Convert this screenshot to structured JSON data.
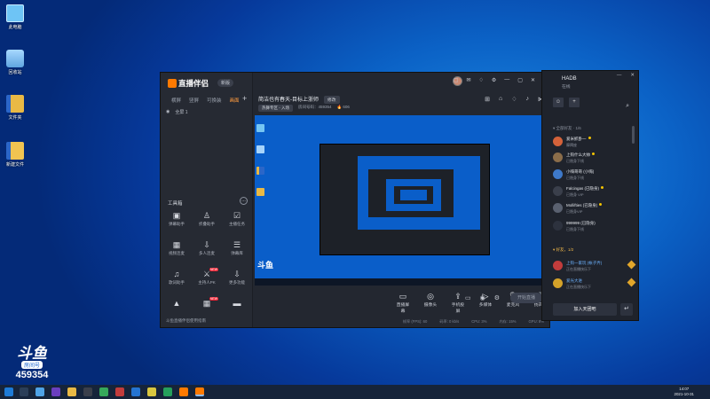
{
  "desktop": {
    "icons": [
      {
        "label": "此电脑"
      },
      {
        "label": "回收站"
      },
      {
        "label": "文件夹"
      },
      {
        "label": "新建文件"
      },
      {
        "label": "文件夹"
      }
    ]
  },
  "main_window": {
    "app_name": "直播伴侣",
    "version_pill": "新版",
    "scene_tabs": [
      "横屏",
      "竖屏",
      "可换装",
      "画面"
    ],
    "active_scene_tab": "画面",
    "add_tab": "+",
    "scene_row": [
      "◉",
      "全屏 1"
    ],
    "tools_title": "工具箱",
    "tools_more": "…",
    "tools": [
      {
        "label": "弹幕助手",
        "icon": "▣"
      },
      {
        "label": "折叠助手",
        "icon": "♙"
      },
      {
        "label": "主播任务",
        "icon": "☑"
      },
      {
        "label": "视频连麦",
        "icon": "▦"
      },
      {
        "label": "多人连麦",
        "icon": "⇩"
      },
      {
        "label": "弹幕库",
        "icon": "☰"
      },
      {
        "label": "歌词助手",
        "icon": "♫"
      },
      {
        "label": "主持人PK",
        "icon": "⚔",
        "badge": "NEW"
      },
      {
        "label": "更多功能",
        "icon": "⇩"
      },
      {
        "label": "",
        "icon": "▲"
      },
      {
        "label": "",
        "icon": "▦",
        "badge": "NEW"
      },
      {
        "label": "",
        "icon": "▬"
      }
    ],
    "footer_note": "斗鱼直播伴侣使用指南",
    "room_title": "简洁也有春天-目标上浙师",
    "edit_btn": "修改",
    "room_category": "热舞专区 - 入场",
    "room_id_label": "房间号码：459354",
    "fans": "606",
    "bottom_tools": [
      {
        "label": "直播屏幕",
        "icon": "▭"
      },
      {
        "label": "摄像头",
        "icon": "◎"
      },
      {
        "label": "手机投屏",
        "icon": "⇪"
      },
      {
        "label": "多媒体",
        "icon": "▷"
      },
      {
        "label": "麦克风",
        "icon": "🎙"
      },
      {
        "label": "扬声器",
        "icon": "🔊"
      }
    ],
    "live_button": "开始直播",
    "status": [
      "帧率 (FPS): 60",
      "码率: 0 kb/s",
      "CPU: 3%",
      "内存: 15%",
      "GPU: 8%"
    ]
  },
  "friends_window": {
    "username": "HADB",
    "status": "在线",
    "section_a": "▾ 全部好友 · 1/6",
    "section_b": "▾ 好友，1/2",
    "friends": [
      {
        "name": "爱米抓卧一",
        "status": "摩羯座",
        "avatar_color": "#d4623a"
      },
      {
        "name": "上钩什么大帅",
        "status": "已隐身下线",
        "avatar_color": "#8b6d4a"
      },
      {
        "name": "小嗨哥哥 (小嗨)",
        "status": "已隐身下线",
        "avatar_color": "#3e79c9"
      },
      {
        "name": "Falcingas (已隐身)",
        "status": "已隐身 VIP",
        "avatar_color": "#3a3f4b"
      },
      {
        "name": "Mollifties (已隐身)",
        "status": "已隐身VIP",
        "avatar_color": "#5a6170"
      },
      {
        "name": "999999 (已隐身)",
        "status": "已隐身下线",
        "avatar_color": "#2d323e"
      },
      {
        "name": "上钩一家玩 (帐子弄)",
        "status": "正在直播快乐下",
        "avatar_color": "#c23c3c"
      },
      {
        "name": "爱光大进",
        "status": "正在直播快乐下",
        "avatar_color": "#d4a229"
      }
    ],
    "join_button": "加入天团吧",
    "exit_icon": "↵"
  },
  "watermark": {
    "logo": "斗鱼",
    "sub": "房间号",
    "room": "459354"
  },
  "taskbar": {
    "time": "14:07",
    "date": "2021-10-31",
    "lang": "中"
  }
}
